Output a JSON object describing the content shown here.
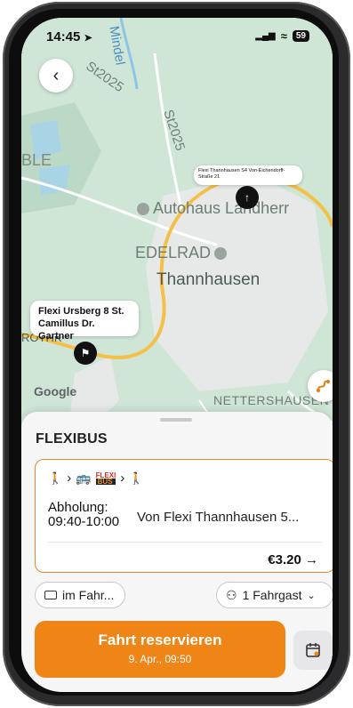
{
  "status_bar": {
    "time": "14:45",
    "signal": "▂▄▆",
    "wifi": "≈",
    "battery": "59"
  },
  "map": {
    "labels": {
      "mindel": "Mindel",
      "st2025_a": "St2025",
      "st2025_b": "St2025",
      "ble": "BLE",
      "autohaus": "Autohaus Landherr",
      "edelrad": "EDELRAD",
      "thannhausen": "Thannhausen",
      "nettershausen": "NETTERSHAUSEN",
      "rothk": "ROTHK"
    },
    "callout_destination": "Flexi Thannhausen S4 Von-Eichendorff-Straße 21",
    "callout_origin": "Flexi Ursberg 8 St. Camillus Dr. Gartner",
    "attribution": "Google"
  },
  "sheet": {
    "title": "FLEXIBUS",
    "card": {
      "step_walk_1": "🚶",
      "step_sep_1": "›",
      "flexi_top": "FLEXI",
      "flexi_bottom": "BUS",
      "step_sep_2": "›",
      "step_walk_2": "🚶",
      "pickup_label": "Abholung:",
      "pickup_time": "09:40-10:00",
      "pickup_destination": "Von Flexi Thannhausen 5...",
      "price": "€3.20 →"
    },
    "payment_chip": "im Fahr...",
    "passenger_chip": "1 Fahrgast",
    "reserve_label": "Fahrt reservieren",
    "reserve_sublabel": "9. Apr., 09:50"
  },
  "colors": {
    "accent": "#ef8417",
    "card_border": "#e38b2c",
    "road": "#f4c048"
  }
}
